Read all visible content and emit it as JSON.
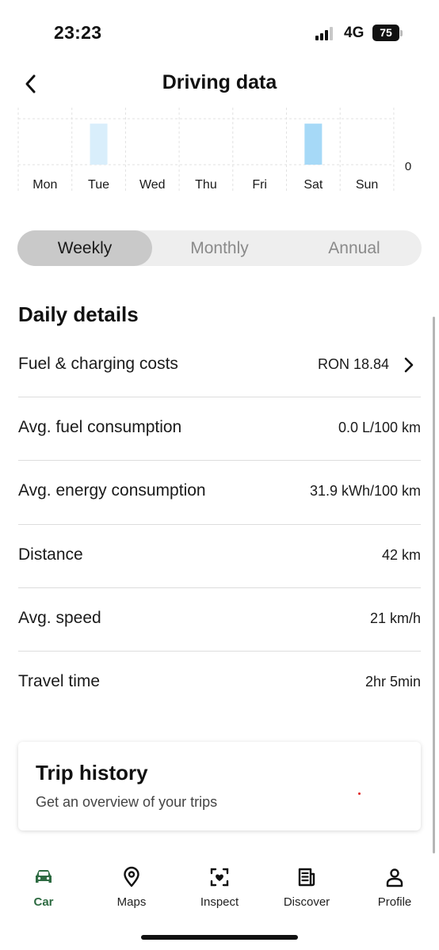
{
  "status_bar": {
    "time": "23:23",
    "network": "4G",
    "battery": "75"
  },
  "header": {
    "title": "Driving data",
    "back_icon": "chevron-left-icon"
  },
  "chart_data": {
    "type": "bar",
    "categories": [
      "Mon",
      "Tue",
      "Wed",
      "Thu",
      "Fri",
      "Sat",
      "Sun"
    ],
    "values": [
      0,
      0.72,
      0,
      0,
      0,
      0.72,
      0
    ],
    "value_colors": [
      "#d9eefb",
      "#d9eefb",
      "#d9eefb",
      "#d9eefb",
      "#d9eefb",
      "#a6d9f7",
      "#d9eefb"
    ],
    "y_tick_label": "0",
    "grid": true
  },
  "period_tabs": {
    "items": [
      {
        "label": "Weekly",
        "active": true
      },
      {
        "label": "Monthly",
        "active": false
      },
      {
        "label": "Annual",
        "active": false
      }
    ]
  },
  "details": {
    "title": "Daily details",
    "rows": [
      {
        "label": "Fuel & charging costs",
        "value": "RON 18.84",
        "clickable": true
      },
      {
        "label": "Avg. fuel consumption",
        "value": "0.0 L/100 km",
        "clickable": false
      },
      {
        "label": "Avg. energy consumption",
        "value": "31.9 kWh/100 km",
        "clickable": false
      },
      {
        "label": "Distance",
        "value": "42 km",
        "clickable": false
      },
      {
        "label": "Avg. speed",
        "value": "21 km/h",
        "clickable": false
      },
      {
        "label": "Travel time",
        "value": "2hr 5min",
        "clickable": false
      }
    ]
  },
  "trip_history": {
    "title": "Trip history",
    "subtitle": "Get an overview of your trips"
  },
  "bottom_nav": {
    "items": [
      {
        "label": "Car",
        "icon": "car-icon",
        "active": true
      },
      {
        "label": "Maps",
        "icon": "map-pin-icon",
        "active": false
      },
      {
        "label": "Inspect",
        "icon": "inspect-icon",
        "active": false
      },
      {
        "label": "Discover",
        "icon": "news-icon",
        "active": false
      },
      {
        "label": "Profile",
        "icon": "person-icon",
        "active": false
      }
    ]
  },
  "colors": {
    "accent": "#2e6b42",
    "bar_light": "#d9eefb",
    "bar_selected": "#a6d9f7"
  }
}
